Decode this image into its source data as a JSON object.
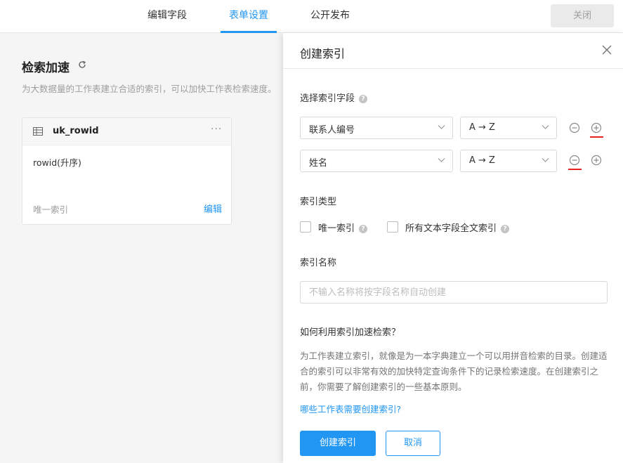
{
  "topbar": {
    "tabs": [
      {
        "label": "编辑字段",
        "active": false
      },
      {
        "label": "表单设置",
        "active": true
      },
      {
        "label": "公开发布",
        "active": false
      }
    ],
    "close_label": "关闭"
  },
  "left": {
    "title": "检索加速",
    "description": "为大数据量的工作表建立合适的索引，可以加快工作表检索速度。",
    "index_card": {
      "name": "uk_rowid",
      "more": "···",
      "field": "rowid(升序)",
      "type": "唯一索引",
      "edit_label": "编辑"
    }
  },
  "drawer": {
    "title": "创建索引",
    "field_section_label": "选择索引字段",
    "field_rows": [
      {
        "field": "联系人编号",
        "order": "A → Z"
      },
      {
        "field": "姓名",
        "order": "A → Z"
      }
    ],
    "type_section_label": "索引类型",
    "type_options": [
      {
        "label": "唯一索引",
        "checked": false
      },
      {
        "label": "所有文本字段全文索引",
        "checked": false
      }
    ],
    "name_section_label": "索引名称",
    "name_placeholder": "不输入名称将按字段名称自动创建",
    "help_title": "如何利用索引加速检索？",
    "help_body": "为工作表建立索引，就像是为一本字典建立一个可以用拼音检索的目录。创建适合的索引可以非常有效的加快特定查询条件下的记录检索速度。在创建索引之前，你需要了解创建索引的一些基本原则。",
    "help_link": "哪些工作表需要创建索引?",
    "create_label": "创建索引",
    "cancel_label": "取消"
  },
  "colors": {
    "accent": "#2196f3",
    "highlight_mark": "#e8231f"
  }
}
